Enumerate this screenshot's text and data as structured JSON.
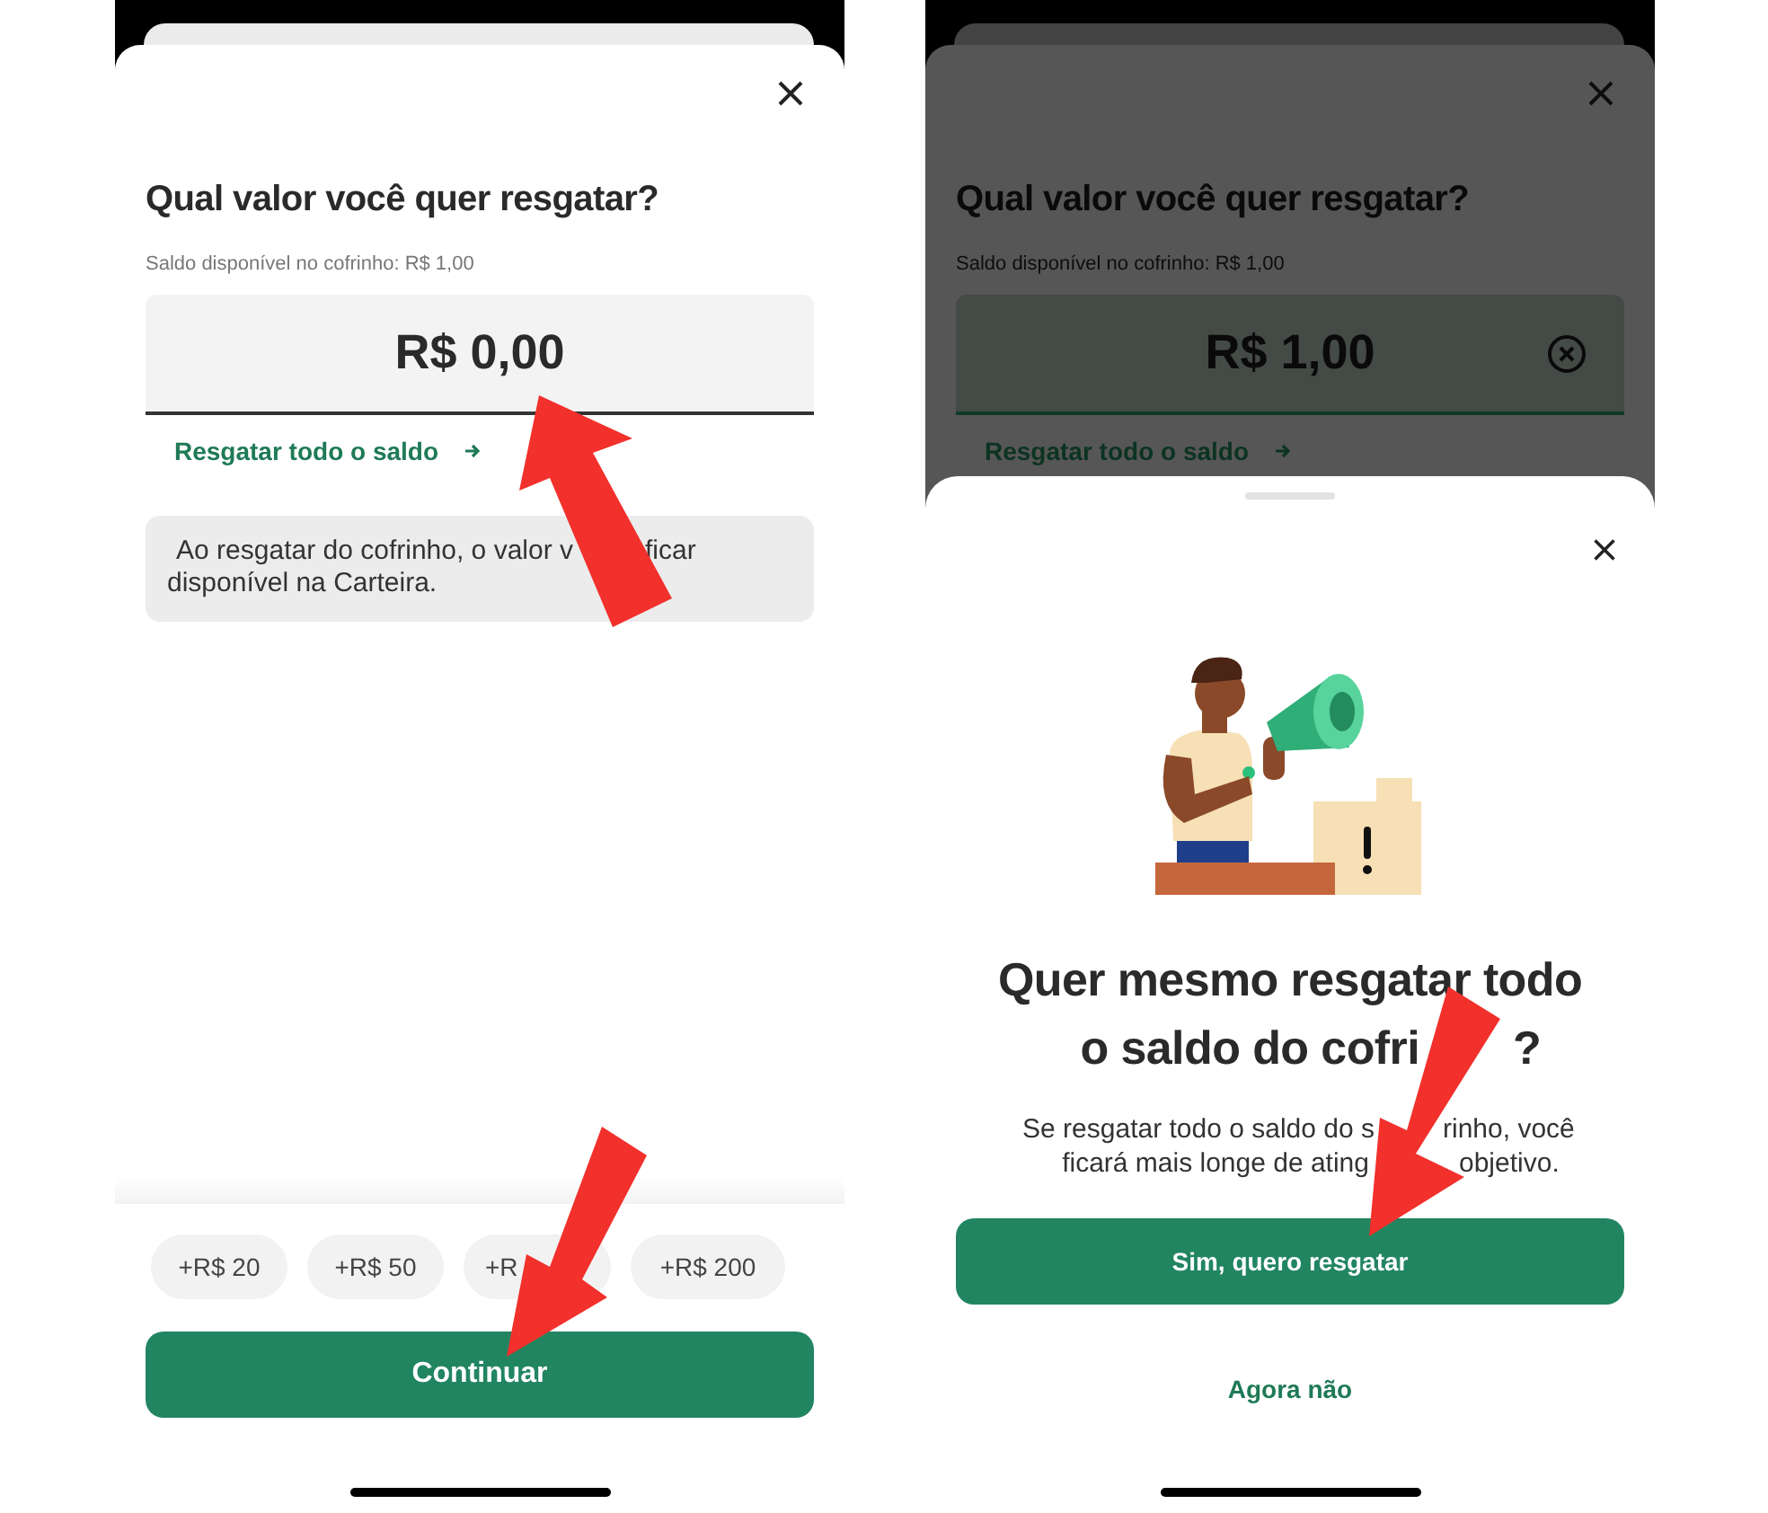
{
  "amount_screen": {
    "dimmed": false,
    "title": "Qual valor você quer resgatar?",
    "balance_label": "Saldo disponível no cofrinho: R$ 1,00",
    "amount": {
      "value": "R$ 0,00",
      "clearable": false
    },
    "withdraw_all_link": "Resgatar todo o saldo",
    "info_lines": [
      [
        "Ao resgatar do cofrinho, o valor v",
        "ficar"
      ],
      [
        "disponível na Carteira."
      ]
    ],
    "quick_amounts": [
      "+R$ 20",
      "+R$ 50",
      "+R",
      "+R$ 200"
    ],
    "button": "Continuar"
  },
  "background_screen": {
    "dimmed": true,
    "title": "Qual valor você quer resgatar?",
    "balance_label": "Saldo disponível no cofrinho: R$ 1,00",
    "amount": {
      "value": "R$ 1,00",
      "clearable": true
    },
    "withdraw_all_link": "Resgatar todo o saldo"
  },
  "confirm_dialog": {
    "title_lines": [
      [
        "Quer mesmo resgatar todo"
      ],
      [
        "o saldo do cofri",
        "?"
      ]
    ],
    "body_lines": [
      [
        "Se resgatar todo o saldo do s",
        "rinho, você"
      ],
      [
        "ficará mais longe de ating",
        "objetivo."
      ]
    ],
    "primary_button": "Sim, quero resgatar",
    "secondary_button": "Agora não"
  }
}
